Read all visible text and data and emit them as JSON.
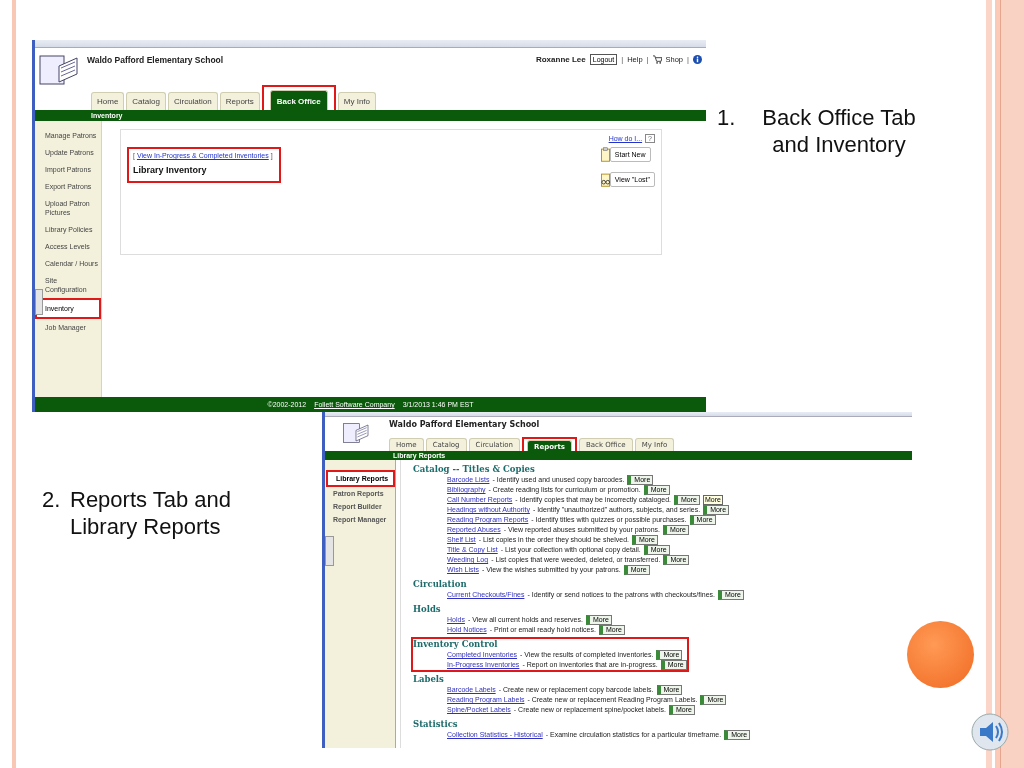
{
  "back_office_screen": {
    "school": "Waldo Pafford Elementary School",
    "user": "Roxanne Lee",
    "logout": "Logout",
    "sep_1": "|",
    "help": "Help",
    "sep_2": "|",
    "shop": "Shop",
    "sep_3": "|",
    "tabs": [
      {
        "label": "Home",
        "selected": false
      },
      {
        "label": "Catalog",
        "selected": false
      },
      {
        "label": "Circulation",
        "selected": false
      },
      {
        "label": "Reports",
        "selected": false
      },
      {
        "label": "Back Office",
        "selected": true
      },
      {
        "label": "My Info",
        "selected": false
      }
    ],
    "subnav": "Inventory",
    "sidebar": [
      {
        "label": "Manage Patrons",
        "selected": false
      },
      {
        "label": "Update Patrons",
        "selected": false
      },
      {
        "label": "Import Patrons",
        "selected": false
      },
      {
        "label": "Export Patrons",
        "selected": false
      },
      {
        "label": "Upload Patron Pictures",
        "selected": false
      },
      {
        "label": "Library Policies",
        "selected": false
      },
      {
        "label": "Access Levels",
        "selected": false
      },
      {
        "label": "Calendar / Hours",
        "selected": false
      },
      {
        "label": "Site Configuration",
        "selected": false
      },
      {
        "label": "Inventory",
        "selected": true
      },
      {
        "label": "Job Manager",
        "selected": false
      }
    ],
    "how_do_i": "How do I...",
    "help_mark": "?",
    "bracket_left": "[",
    "inventories_link": "View In-Progress & Completed Inventories",
    "bracket_right": "]",
    "heading": "Library Inventory",
    "start_new": "Start New",
    "view_lost": "View \"Lost\"",
    "footer": {
      "copyright": "©2002-2012",
      "company": "Follett Software Company",
      "timestamp": "3/1/2013 1:46 PM EST"
    }
  },
  "caption_1": {
    "number": "1.",
    "text": "Back Office Tab and Inventory"
  },
  "caption_2": {
    "number": "2.",
    "text": "Reports Tab and Library Reports"
  },
  "reports_screen": {
    "school": "Waldo Pafford Elementary School",
    "tabs": [
      {
        "label": "Home",
        "selected": false
      },
      {
        "label": "Catalog",
        "selected": false
      },
      {
        "label": "Circulation",
        "selected": false
      },
      {
        "label": "Reports",
        "selected": true
      },
      {
        "label": "Back Office",
        "selected": false
      },
      {
        "label": "My Info",
        "selected": false
      }
    ],
    "subnav": "Library Reports",
    "sidebar": [
      {
        "label": "Library Reports",
        "selected": true
      },
      {
        "label": "Patron Reports",
        "selected": false
      },
      {
        "label": "Report Builder",
        "selected": false
      },
      {
        "label": "Report Manager",
        "selected": false
      }
    ],
    "tooltip": "More",
    "sections": [
      {
        "title": "Catalog -- Titles & Copies",
        "highlighted": false,
        "reports": [
          {
            "link": "Barcode Lists",
            "description": "- Identify used and unused copy barcodes.",
            "more": "More"
          },
          {
            "link": "Bibliography",
            "description": "- Create reading lists for curriculum or promotion.",
            "more": "More"
          },
          {
            "link": "Call Number Reports",
            "description": "- Identify copies that may be incorrectly cataloged.",
            "more": "More",
            "tooltip": true
          },
          {
            "link": "Headings without Authority",
            "description": "- Identify \"unauthorized\" authors, subjects, and series.",
            "more": "More"
          },
          {
            "link": "Reading Program Reports",
            "description": "- Identify titles with quizzes or possible purchases.",
            "more": "More"
          },
          {
            "link": "Reported Abuses",
            "description": "- View reported abuses submitted by your patrons.",
            "more": "More"
          },
          {
            "link": "Shelf List",
            "description": "- List copies in the order they should be shelved.",
            "more": "More"
          },
          {
            "link": "Title & Copy List",
            "description": "- List your collection with optional copy detail.",
            "more": "More"
          },
          {
            "link": "Weeding Log",
            "description": "- List copies that were weeded, deleted, or transferred.",
            "more": "More"
          },
          {
            "link": "Wish Lists",
            "description": "- View the wishes submitted by your patrons.",
            "more": "More"
          }
        ]
      },
      {
        "title": "Circulation",
        "highlighted": false,
        "reports": [
          {
            "link": "Current Checkouts/Fines",
            "description": "- Identify or send notices to the patrons with checkouts/fines.",
            "more": "More"
          }
        ]
      },
      {
        "title": "Holds",
        "highlighted": false,
        "reports": [
          {
            "link": "Holds",
            "description": "- View all current holds and reserves.",
            "more": "More"
          },
          {
            "link": "Hold Notices",
            "description": "- Print or email ready hold notices.",
            "more": "More"
          }
        ]
      },
      {
        "title": "Inventory Control",
        "highlighted": true,
        "reports": [
          {
            "link": "Completed Inventories",
            "description": "- View the results of completed inventories.",
            "more": "More"
          },
          {
            "link": "In-Progress Inventories",
            "description": "- Report on inventories that are in-progress.",
            "more": "More"
          }
        ]
      },
      {
        "title": "Labels",
        "highlighted": false,
        "reports": [
          {
            "link": "Barcode Labels",
            "description": "- Create new or replacement copy barcode labels.",
            "more": "More"
          },
          {
            "link": "Reading Program Labels",
            "description": "- Create new or replacement Reading Program Labels.",
            "more": "More"
          },
          {
            "link": "Spine/Pocket Labels",
            "description": "- Create new or replacement spine/pocket labels.",
            "more": "More"
          }
        ]
      },
      {
        "title": "Statistics",
        "highlighted": false,
        "reports": [
          {
            "link": "Collection Statistics - Historical",
            "description": "- Examine circulation statistics for a particular timeframe.",
            "more": "More"
          }
        ]
      }
    ]
  }
}
